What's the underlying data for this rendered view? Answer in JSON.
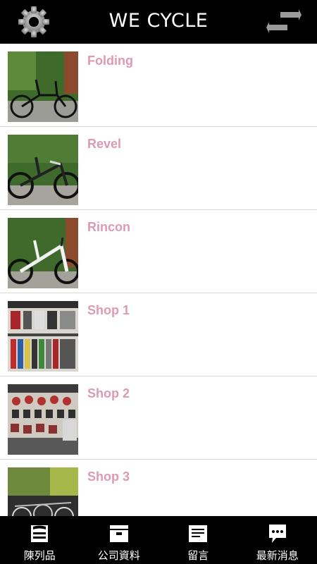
{
  "header": {
    "title": "WE CYCLE",
    "left_icon": "gear-icon",
    "right_icon": "swap-arrows-icon"
  },
  "items": [
    {
      "label": "Folding",
      "thumb": "folding-bike-photo"
    },
    {
      "label": "Revel",
      "thumb": "revel-bike-photo"
    },
    {
      "label": "Rincon",
      "thumb": "rincon-bike-photo"
    },
    {
      "label": "Shop 1",
      "thumb": "shop-photo"
    },
    {
      "label": "Shop 2",
      "thumb": "shop-photo"
    },
    {
      "label": "Shop 3",
      "thumb": "shop-photo"
    }
  ],
  "tabs": [
    {
      "label": "陳列品",
      "icon": "showcase-icon"
    },
    {
      "label": "公司資料",
      "icon": "company-info-icon"
    },
    {
      "label": "留言",
      "icon": "message-board-icon"
    },
    {
      "label": "最新消息",
      "icon": "news-chat-icon"
    }
  ],
  "colors": {
    "header_bg": "#000000",
    "item_label": "#de9aaf",
    "tabbar_bg": "#000000"
  }
}
